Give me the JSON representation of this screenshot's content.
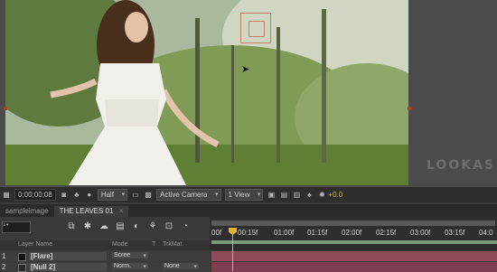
{
  "viewer": {
    "watermark": "LOOKAS",
    "toolbar": {
      "timecode": "0;00;00;08",
      "resolution": "Half",
      "camera": "Active Camera",
      "view": "1 View",
      "exposure": "+0.0"
    }
  },
  "tabs": [
    {
      "label": "sampleimage",
      "active": false
    },
    {
      "label": "THE LEAVES 01",
      "active": true,
      "close": "×"
    }
  ],
  "timeline": {
    "search_placeholder": "",
    "ruler": [
      "00f",
      "00:15f",
      "01:00f",
      "01:15f",
      "02:00f",
      "02:15f",
      "03:00f",
      "03:15f",
      "04:0"
    ],
    "columns": {
      "name": "Layer Name",
      "mode": "Mode",
      "t": "T",
      "trkmat": "TrkMat"
    },
    "layers": [
      {
        "num": "1",
        "name": "[Flare]",
        "mode": "Scree",
        "trkmat": ""
      },
      {
        "num": "2",
        "name": "[Null 2]",
        "mode": "Norm.",
        "trkmat": "None"
      }
    ]
  },
  "colors": {
    "playhead": "#e6b52a",
    "layer_bar": "#8f4a5a",
    "marker": "#c47a6a"
  }
}
